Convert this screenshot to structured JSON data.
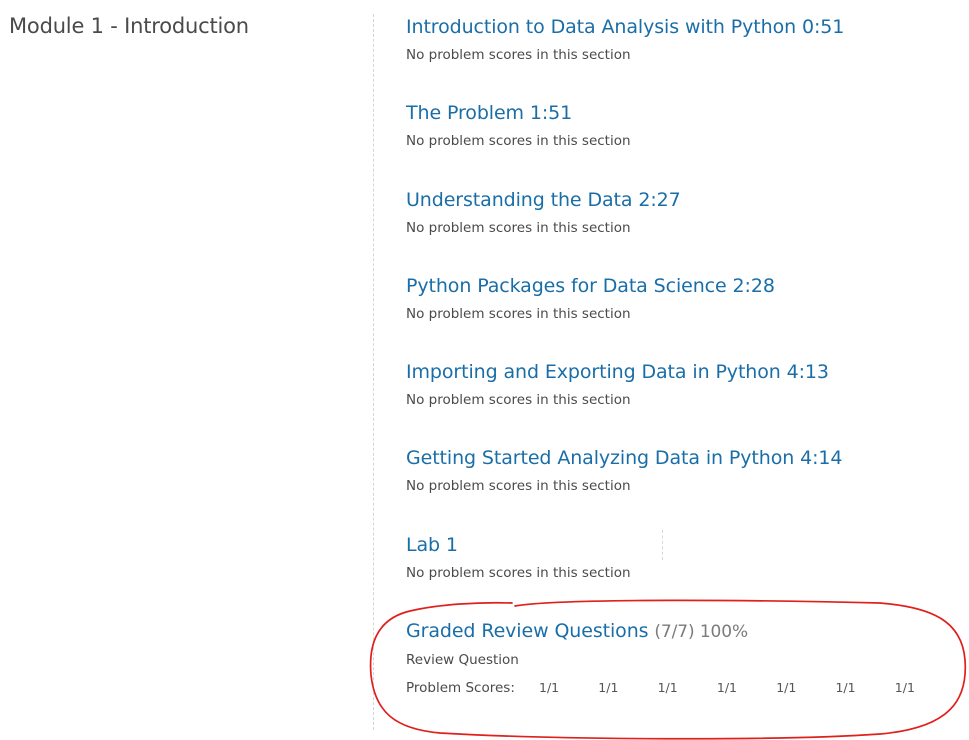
{
  "module": {
    "title": "Module 1 - Introduction"
  },
  "sections": [
    {
      "title": "Introduction to Data Analysis with Python 0:51",
      "subtitle": "No problem scores in this section"
    },
    {
      "title": "The Problem 1:51",
      "subtitle": "No problem scores in this section"
    },
    {
      "title": "Understanding the Data 2:27",
      "subtitle": "No problem scores in this section"
    },
    {
      "title": "Python Packages for Data Science 2:28",
      "subtitle": "No problem scores in this section"
    },
    {
      "title": "Importing and Exporting Data in Python 4:13",
      "subtitle": "No problem scores in this section"
    },
    {
      "title": "Getting Started Analyzing Data in Python 4:14",
      "subtitle": "No problem scores in this section"
    },
    {
      "title": "Lab 1",
      "subtitle": "No problem scores in this section"
    }
  ],
  "graded": {
    "title": "Graded Review Questions",
    "score_summary": "(7/7) 100%",
    "subtitle": "Review Question",
    "scores_label": "Problem Scores:",
    "scores": [
      "1/1",
      "1/1",
      "1/1",
      "1/1",
      "1/1",
      "1/1",
      "1/1"
    ]
  },
  "colors": {
    "link": "#1a6ea8",
    "text": "#4a4a4a",
    "muted": "#7b7b7b",
    "annotation": "#e0201c"
  }
}
